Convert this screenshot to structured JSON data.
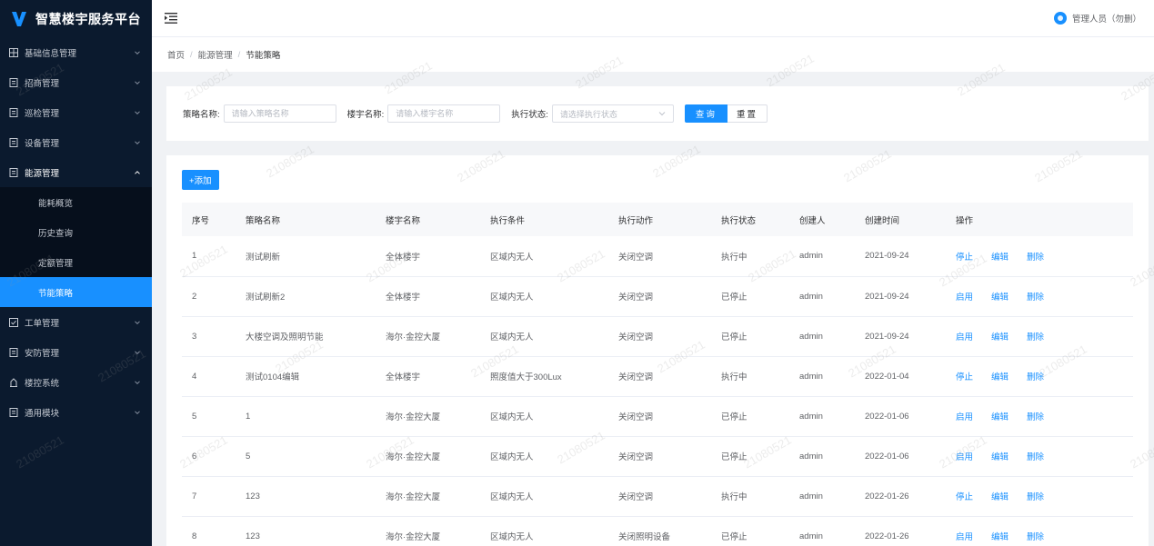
{
  "brand": {
    "title": "智慧楼宇服务平台"
  },
  "sidebar": {
    "items": [
      {
        "label": "基础信息管理",
        "icon": "grid-icon"
      },
      {
        "label": "招商管理",
        "icon": "doc-icon"
      },
      {
        "label": "巡检管理",
        "icon": "doc-icon"
      },
      {
        "label": "设备管理",
        "icon": "doc-icon"
      },
      {
        "label": "能源管理",
        "icon": "doc-icon",
        "open": true
      },
      {
        "label": "工单管理",
        "icon": "check-icon"
      },
      {
        "label": "安防管理",
        "icon": "doc-icon"
      },
      {
        "label": "楼控系统",
        "icon": "building-icon"
      },
      {
        "label": "通用模块",
        "icon": "doc-icon"
      }
    ],
    "submenu": [
      {
        "label": "能耗概览"
      },
      {
        "label": "历史查询"
      },
      {
        "label": "定额管理"
      },
      {
        "label": "节能策略",
        "active": true
      }
    ]
  },
  "header": {
    "user": "管理人员（勿删）"
  },
  "breadcrumb": [
    "首页",
    "能源管理",
    "节能策略"
  ],
  "filters": {
    "strategy_label": "策略名称:",
    "strategy_placeholder": "请输入策略名称",
    "building_label": "楼宇名称:",
    "building_placeholder": "请输入楼宇名称",
    "status_label": "执行状态:",
    "status_placeholder": "请选择执行状态",
    "search_button": "查询",
    "reset_button": "重置"
  },
  "add_button": "+添加",
  "table": {
    "columns": [
      "序号",
      "策略名称",
      "楼宇名称",
      "执行条件",
      "执行动作",
      "执行状态",
      "创建人",
      "创建时间",
      "操作"
    ],
    "rows": [
      {
        "no": "1",
        "name": "测试刷新",
        "building": "全体楼宇",
        "condition": "区域内无人",
        "action": "关闭空调",
        "status": "执行中",
        "creator": "admin",
        "created": "2021-09-24",
        "toggle": "停止",
        "edit": "编辑",
        "delete": "删除"
      },
      {
        "no": "2",
        "name": "测试刷新2",
        "building": "全体楼宇",
        "condition": "区域内无人",
        "action": "关闭空调",
        "status": "已停止",
        "creator": "admin",
        "created": "2021-09-24",
        "toggle": "启用",
        "edit": "编辑",
        "delete": "删除"
      },
      {
        "no": "3",
        "name": "大楼空调及照明节能",
        "building": "海尔·金控大厦",
        "condition": "区域内无人",
        "action": "关闭空调",
        "status": "已停止",
        "creator": "admin",
        "created": "2021-09-24",
        "toggle": "启用",
        "edit": "编辑",
        "delete": "删除"
      },
      {
        "no": "4",
        "name": "测试0104编辑",
        "building": "全体楼宇",
        "condition": "照度值大于300Lux",
        "action": "关闭空调",
        "status": "执行中",
        "creator": "admin",
        "created": "2022-01-04",
        "toggle": "停止",
        "edit": "编辑",
        "delete": "删除"
      },
      {
        "no": "5",
        "name": "1",
        "building": "海尔·金控大厦",
        "condition": "区域内无人",
        "action": "关闭空调",
        "status": "已停止",
        "creator": "admin",
        "created": "2022-01-06",
        "toggle": "启用",
        "edit": "编辑",
        "delete": "删除"
      },
      {
        "no": "6",
        "name": "5",
        "building": "海尔·金控大厦",
        "condition": "区域内无人",
        "action": "关闭空调",
        "status": "已停止",
        "creator": "admin",
        "created": "2022-01-06",
        "toggle": "启用",
        "edit": "编辑",
        "delete": "删除"
      },
      {
        "no": "7",
        "name": "123",
        "building": "海尔·金控大厦",
        "condition": "区域内无人",
        "action": "关闭空调",
        "status": "执行中",
        "creator": "admin",
        "created": "2022-01-26",
        "toggle": "停止",
        "edit": "编辑",
        "delete": "删除"
      },
      {
        "no": "8",
        "name": "123",
        "building": "海尔·金控大厦",
        "condition": "区域内无人",
        "action": "关闭照明设备",
        "status": "已停止",
        "creator": "admin",
        "created": "2022-01-26",
        "toggle": "启用",
        "edit": "编辑",
        "delete": "删除"
      }
    ]
  },
  "watermark": "21080521",
  "colors": {
    "sidebar_bg": "#0b1a2e",
    "accent": "#1890ff",
    "page_bg": "#f0f2f5"
  }
}
